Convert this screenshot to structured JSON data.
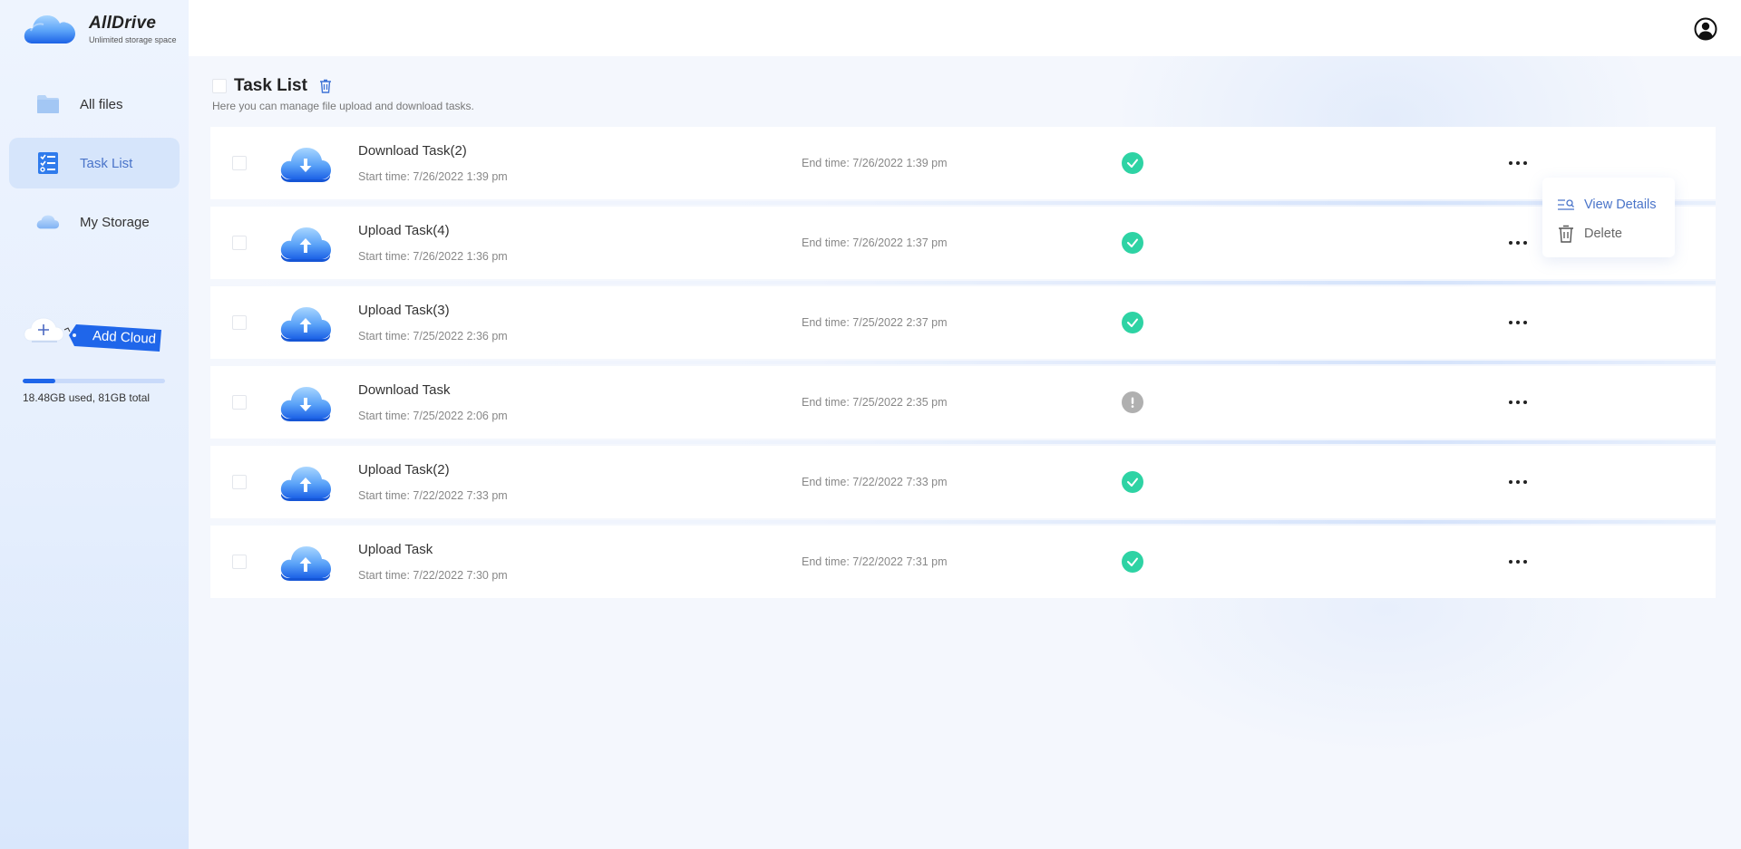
{
  "app": {
    "name": "AllDrive",
    "tagline": "Unlimited storage space"
  },
  "sidebar": {
    "items": [
      {
        "label": "All files",
        "icon": "folder-icon",
        "active": false
      },
      {
        "label": "Task List",
        "icon": "task-list-icon",
        "active": true
      },
      {
        "label": "My Storage",
        "icon": "cloud-icon",
        "active": false
      }
    ],
    "add_cloud_label": "Add Cloud",
    "storage": {
      "used_fraction": 0.228,
      "text": "18.48GB used, 81GB total"
    }
  },
  "header": {
    "user_icon": "user-circle-icon"
  },
  "page": {
    "title": "Task List",
    "subtitle": "Here you can manage file upload and download tasks."
  },
  "tasks": [
    {
      "name": "Download Task(2)",
      "type": "download",
      "start": "Start time: 7/26/2022 1:39 pm",
      "end": "End time: 7/26/2022 1:39 pm",
      "status": "success"
    },
    {
      "name": "Upload Task(4)",
      "type": "upload",
      "start": "Start time: 7/26/2022 1:36 pm",
      "end": "End time: 7/26/2022 1:37 pm",
      "status": "success"
    },
    {
      "name": "Upload Task(3)",
      "type": "upload",
      "start": "Start time: 7/25/2022 2:36 pm",
      "end": "End time: 7/25/2022 2:37 pm",
      "status": "success"
    },
    {
      "name": "Download Task",
      "type": "download",
      "start": "Start time: 7/25/2022 2:06 pm",
      "end": "End time: 7/25/2022 2:35 pm",
      "status": "warning"
    },
    {
      "name": "Upload Task(2)",
      "type": "upload",
      "start": "Start time: 7/22/2022 7:33 pm",
      "end": "End time: 7/22/2022 7:33 pm",
      "status": "success"
    },
    {
      "name": "Upload Task",
      "type": "upload",
      "start": "Start time: 7/22/2022 7:30 pm",
      "end": "End time: 7/22/2022 7:31 pm",
      "status": "success"
    }
  ],
  "context_menu": {
    "items": [
      {
        "label": "View Details",
        "icon": "view-details-icon"
      },
      {
        "label": "Delete",
        "icon": "trash-icon"
      }
    ]
  },
  "colors": {
    "accent": "#4a74c9",
    "brand_blue": "#1f66ea",
    "success": "#2ed3a4",
    "warning": "#b0b0b0"
  }
}
